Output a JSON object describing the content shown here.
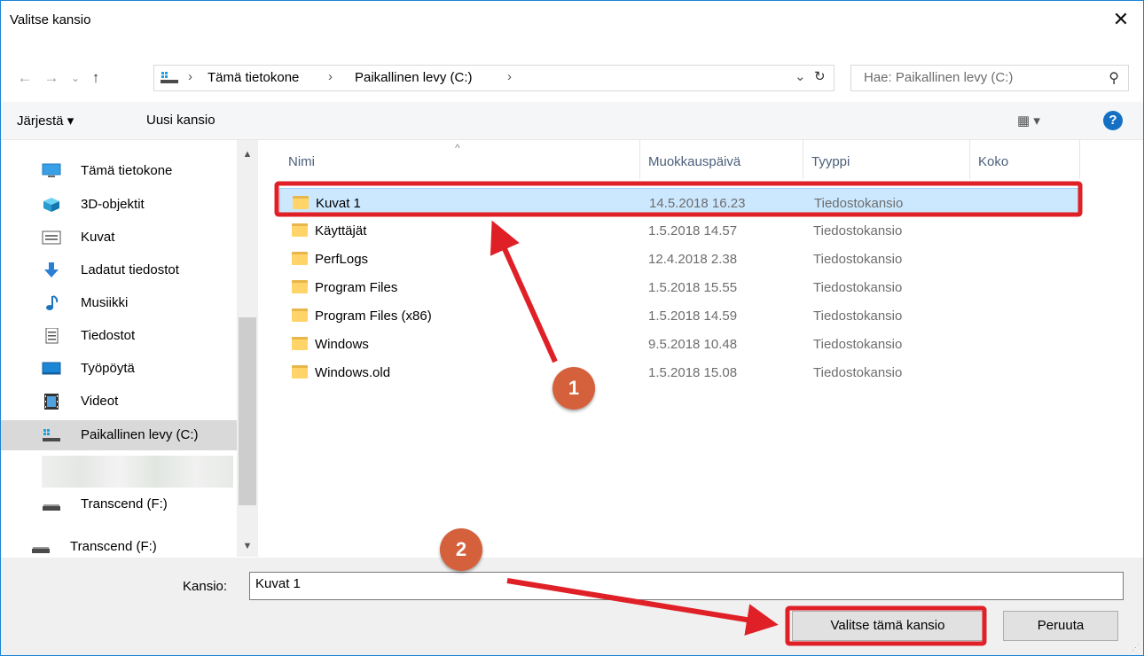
{
  "title": "Valitse kansio",
  "nav": {
    "back_icon": "←",
    "forward_icon": "→",
    "recent_icon": "⌄",
    "up_icon": "↑",
    "path": [
      "Tämä tietokone",
      "Paikallinen levy (C:)"
    ],
    "separator": "›",
    "dropdown_icon": "⌄",
    "refresh_icon": "↻",
    "search_placeholder": "Hae: Paikallinen levy (C:)",
    "search_icon": "⚲"
  },
  "toolbar": {
    "organize": "Järjestä ▾",
    "new_folder": "Uusi kansio",
    "view_icon": "▦ ▾",
    "help": "?"
  },
  "sidebar": {
    "items": [
      {
        "label": "Tämä tietokone",
        "icon": "computer-icon"
      },
      {
        "label": "3D-objektit",
        "icon": "3d-objects-icon"
      },
      {
        "label": "Kuvat",
        "icon": "pictures-icon"
      },
      {
        "label": "Ladatut tiedostot",
        "icon": "downloads-icon"
      },
      {
        "label": "Musiikki",
        "icon": "music-icon"
      },
      {
        "label": "Tiedostot",
        "icon": "documents-icon"
      },
      {
        "label": "Työpöytä",
        "icon": "desktop-icon"
      },
      {
        "label": "Videot",
        "icon": "videos-icon"
      },
      {
        "label": "Paikallinen levy (C:)",
        "icon": "drive-icon"
      },
      {
        "label": "Transcend (F:)",
        "icon": "usb-drive-icon"
      },
      {
        "label": "Transcend (F:)",
        "icon": "usb-drive-icon"
      }
    ]
  },
  "columns": {
    "name": "Nimi",
    "modified": "Muokkauspäivä",
    "type": "Tyyppi",
    "size": "Koko"
  },
  "files": [
    {
      "name": "Kuvat 1",
      "modified": "14.5.2018 16.23",
      "type": "Tiedostokansio"
    },
    {
      "name": "Käyttäjät",
      "modified": "1.5.2018 14.57",
      "type": "Tiedostokansio"
    },
    {
      "name": "PerfLogs",
      "modified": "12.4.2018 2.38",
      "type": "Tiedostokansio"
    },
    {
      "name": "Program Files",
      "modified": "1.5.2018 15.55",
      "type": "Tiedostokansio"
    },
    {
      "name": "Program Files (x86)",
      "modified": "1.5.2018 14.59",
      "type": "Tiedostokansio"
    },
    {
      "name": "Windows",
      "modified": "9.5.2018 10.48",
      "type": "Tiedostokansio"
    },
    {
      "name": "Windows.old",
      "modified": "1.5.2018 15.08",
      "type": "Tiedostokansio"
    }
  ],
  "footer": {
    "folder_label": "Kansio:",
    "folder_value": "Kuvat 1",
    "select_button": "Valitse tämä kansio",
    "cancel_button": "Peruuta"
  },
  "annotations": {
    "badge1": "1",
    "badge2": "2",
    "highlight_color": "#e02027",
    "badge_color": "#d5603c"
  },
  "colors": {
    "selection": "#cce8ff",
    "accent": "#1570c4"
  }
}
